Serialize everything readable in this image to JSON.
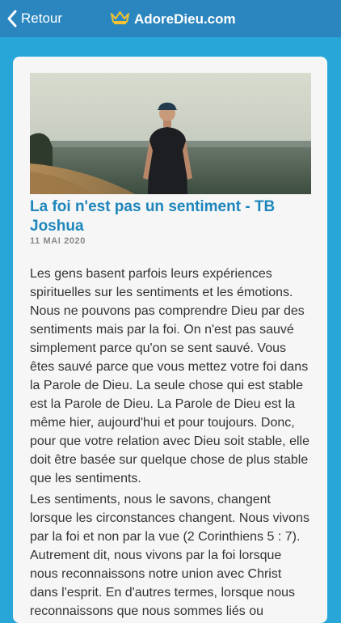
{
  "header": {
    "back_label": "Retour",
    "brand_name": "AdoreDieu.com",
    "icons": {
      "back": "chevron-left-icon",
      "brand": "crown-icon"
    }
  },
  "article": {
    "title": "La foi n'est pas un sentiment - TB Joshua",
    "date": "11 MAI 2020",
    "paragraphs": [
      "Les gens basent parfois leurs expériences spirituelles sur les sentiments et les émotions. Nous ne pouvons pas comprendre Dieu par des sentiments mais par la foi.  On n'est pas sauvé simplement parce qu'on se sent sauvé. Vous êtes sauvé parce que vous mettez votre foi dans la Parole de Dieu. La seule chose qui est stable est la Parole de Dieu. La Parole de Dieu est la même hier, aujourd'hui et pour toujours. Donc, pour que votre relation avec Dieu soit stable, elle doit être basée sur quelque chose de plus stable que les sentiments.",
      "Les sentiments, nous le savons, changent lorsque les circonstances changent. Nous vivons par la foi et non par la vue (2 Corinthiens 5 : 7). Autrement dit, nous vivons par la foi lorsque nous reconnaissons notre union avec Christ dans l'esprit. En d'autres termes, lorsque nous reconnaissons que nous sommes liés ou"
    ]
  },
  "colors": {
    "page_background": "#29a6d8",
    "header_background": "#2b86bf",
    "card_background": "#f6f6f6",
    "title": "#1e86bc",
    "date": "#888888",
    "body_text": "#333333",
    "crown": "#f2c230"
  }
}
